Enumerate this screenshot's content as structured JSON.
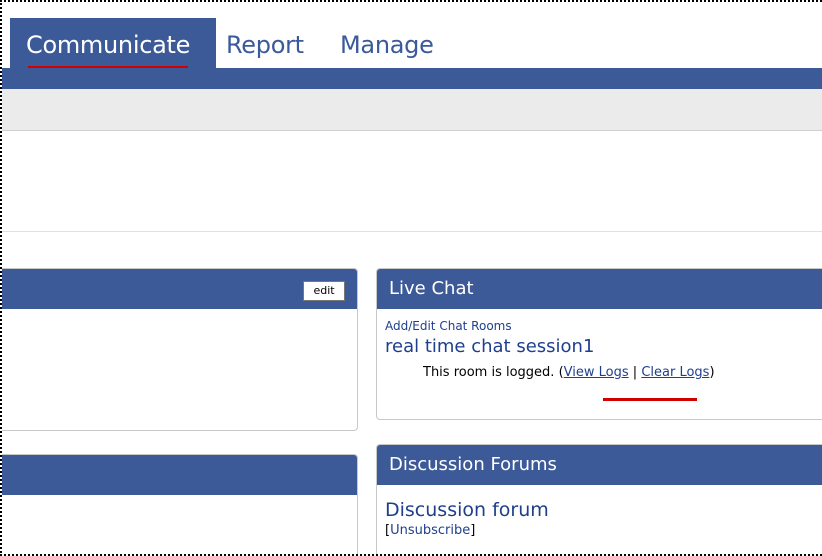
{
  "nav": {
    "tabs": [
      {
        "label": "Communicate",
        "active": true
      },
      {
        "label": "Report",
        "active": false
      },
      {
        "label": "Manage",
        "active": false
      }
    ]
  },
  "left_panel": {
    "edit_label": "edit"
  },
  "live_chat": {
    "title": "Live Chat",
    "add_edit_label": "Add/Edit Chat Rooms",
    "room_name": "real time chat session1",
    "logged_text": "This room is logged.",
    "open_paren": "(",
    "view_logs": "View Logs",
    "separator": "|",
    "clear_logs": "Clear Logs",
    "close_paren": ")"
  },
  "discussion": {
    "title": "Discussion Forums",
    "forum_name": "Discussion forum",
    "bracket_open": "[",
    "unsubscribe": "Unsubscribe",
    "bracket_close": "]"
  },
  "colors": {
    "header_blue": "#3d5a98",
    "link_blue": "#1f3f8c",
    "annotation_red": "#d00000"
  }
}
